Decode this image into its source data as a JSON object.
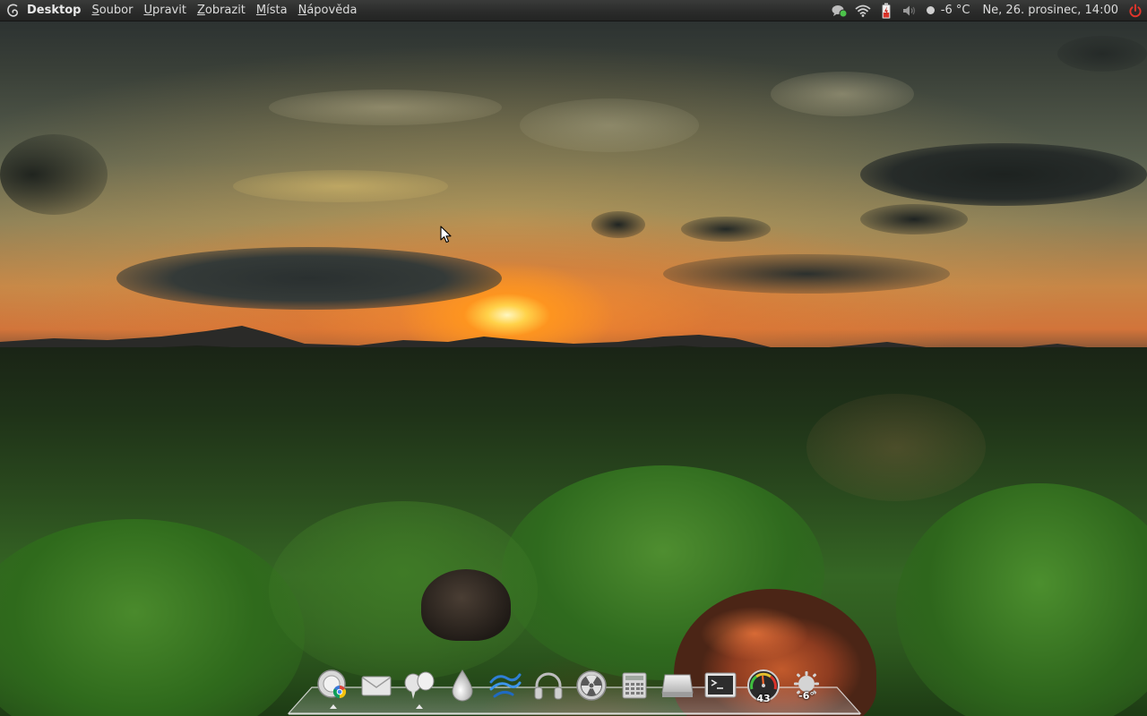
{
  "panel": {
    "app_name": "Desktop",
    "menus": [
      {
        "mnemonic": "S",
        "rest": "oubor"
      },
      {
        "mnemonic": "U",
        "rest": "pravit"
      },
      {
        "mnemonic": "Z",
        "rest": "obrazit"
      },
      {
        "mnemonic": "M",
        "rest": "ísta"
      },
      {
        "mnemonic": "N",
        "rest": "ápověda"
      }
    ],
    "weather_temp": "-6 °C",
    "clock": "Ne, 26. prosinec, 14:00",
    "accent_power": "#e0352b"
  },
  "dock": {
    "items": [
      {
        "icon": "chromium-browser-icon",
        "running": true
      },
      {
        "icon": "mail-icon",
        "running": false
      },
      {
        "icon": "pidgin-chat-icon",
        "running": true
      },
      {
        "icon": "water-drop-icon",
        "running": false
      },
      {
        "icon": "wave-app-icon",
        "running": false
      },
      {
        "icon": "headphones-icon",
        "running": false
      },
      {
        "icon": "radioactive-media-icon",
        "running": false
      },
      {
        "icon": "calculator-icon",
        "running": false
      },
      {
        "icon": "drive-icon",
        "running": false
      },
      {
        "icon": "terminal-icon",
        "running": false
      },
      {
        "icon": "system-monitor-gauge-icon",
        "running": false
      },
      {
        "icon": "weather-applet-icon",
        "running": false
      }
    ],
    "gauge_value": "43",
    "weather_value": "-6°"
  }
}
